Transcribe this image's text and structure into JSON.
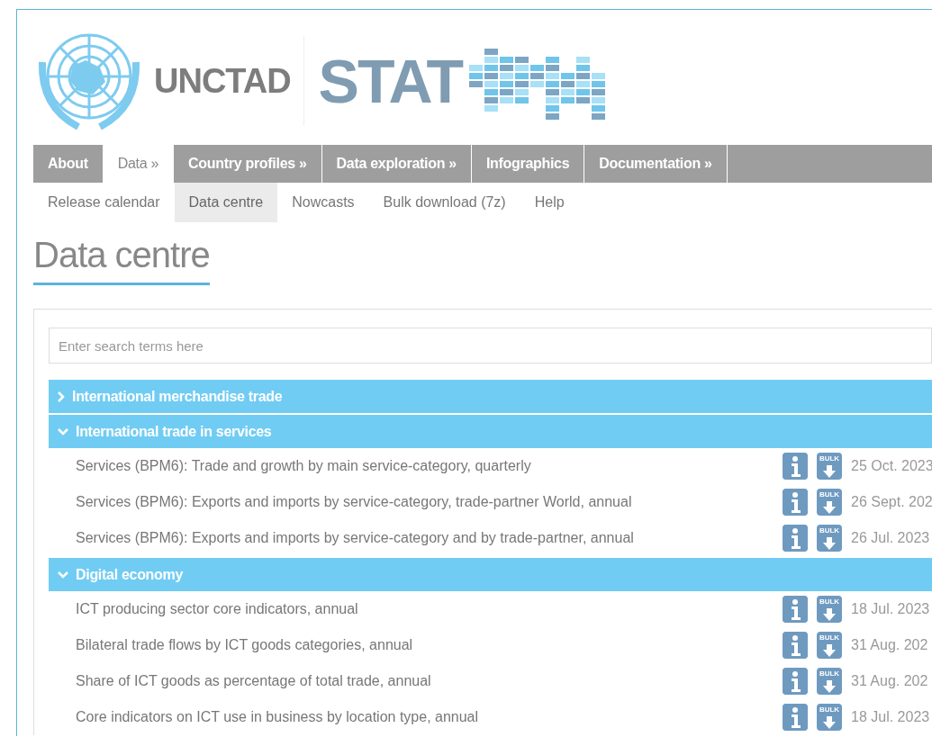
{
  "header": {
    "organization": "UNCTAD",
    "product": "STAT"
  },
  "nav": [
    {
      "label": "About",
      "selected": false
    },
    {
      "label": "Data »",
      "selected": true
    },
    {
      "label": "Country profiles »",
      "selected": false
    },
    {
      "label": "Data exploration »",
      "selected": false
    },
    {
      "label": "Infographics",
      "selected": false
    },
    {
      "label": "Documentation »",
      "selected": false
    }
  ],
  "subnav": [
    {
      "label": "Release calendar",
      "selected": false
    },
    {
      "label": "Data centre",
      "selected": true
    },
    {
      "label": "Nowcasts",
      "selected": false
    },
    {
      "label": "Bulk download (7z)",
      "selected": false
    },
    {
      "label": "Help",
      "selected": false
    }
  ],
  "page_title": "Data centre",
  "search": {
    "placeholder": "Enter search terms here"
  },
  "categories": [
    {
      "title": "International merchandise trade",
      "expanded": false
    },
    {
      "title": "International trade in services",
      "expanded": true,
      "datasets": [
        {
          "title": "Services (BPM6): Trade and growth by main service-category, quarterly",
          "bulk_label": "BULK",
          "date": "25 Oct. 2023"
        },
        {
          "title": "Services (BPM6): Exports and imports by service-category, trade-partner World, annual",
          "bulk_label": "BULK",
          "date": "26 Sept. 202"
        },
        {
          "title": "Services (BPM6): Exports and imports by service-category and by trade-partner, annual",
          "bulk_label": "BULK",
          "date": "26 Jul. 2023"
        }
      ]
    },
    {
      "title": "Digital economy",
      "expanded": true,
      "datasets": [
        {
          "title": "ICT producing sector core indicators, annual",
          "bulk_label": "BULK",
          "date": "18 Jul. 2023"
        },
        {
          "title": "Bilateral trade flows by ICT goods categories, annual",
          "bulk_label": "BULK",
          "date": "31 Aug. 202"
        },
        {
          "title": "Share of ICT goods as percentage of total trade, annual",
          "bulk_label": "BULK",
          "date": "31 Aug. 202"
        },
        {
          "title": "Core indicators on ICT use in business by location type, annual",
          "bulk_label": "BULK",
          "date": "18 Jul. 2023"
        }
      ]
    }
  ]
}
